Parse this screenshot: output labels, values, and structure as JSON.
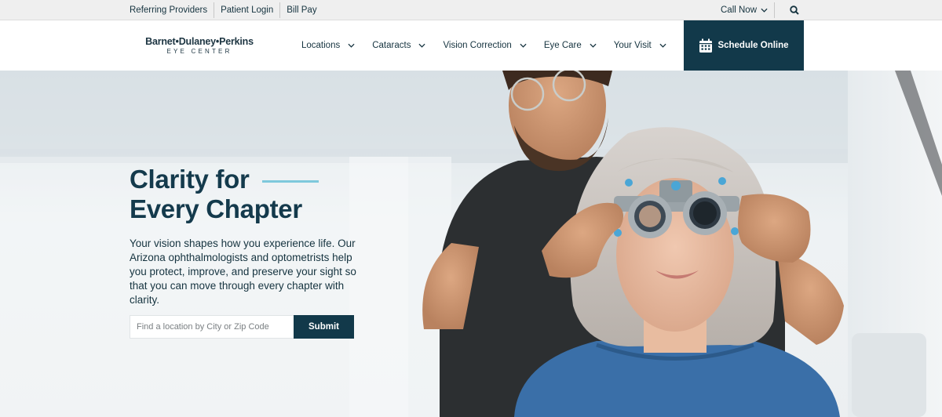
{
  "utility_bar": {
    "links": [
      "Referring Providers",
      "Patient Login",
      "Bill Pay"
    ],
    "call_now": "Call Now"
  },
  "logo": {
    "name": "Barnet•Dulaney•Perkins",
    "sub": "EYE CENTER"
  },
  "nav": {
    "items": [
      "Locations",
      "Cataracts",
      "Vision Correction",
      "Eye Care",
      "Your Visit"
    ],
    "schedule_label": "Schedule Online"
  },
  "hero": {
    "headline_line1": "Clarity for",
    "headline_line2": "Every Chapter",
    "body": "Your vision shapes how you experience life. Our Arizona ophthalmologists and optometrists help you protect, improve, and preserve your sight so that you can move through every chapter with clarity.",
    "search": {
      "placeholder": "Find a location by City or Zip Code",
      "value": "",
      "submit_label": "Submit"
    }
  },
  "colors": {
    "primary_dark": "#12394a",
    "accent_rule": "#7ec8dc",
    "text": "#15333f"
  },
  "icons": [
    "chevron-down-icon",
    "search-icon",
    "calendar-icon"
  ]
}
